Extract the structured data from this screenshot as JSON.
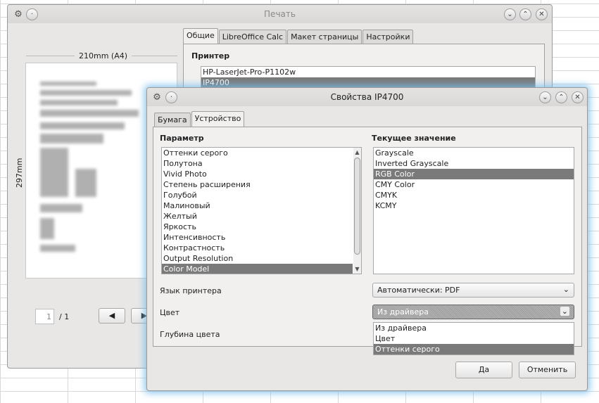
{
  "print_dialog": {
    "title": "Печать",
    "page_width_label": "210mm (A4)",
    "page_height_label": "297mm",
    "tabs": [
      "Общие",
      "LibreOffice Calc",
      "Макет страницы",
      "Настройки"
    ],
    "printer_section": "Принтер",
    "printers": [
      "HP-LaserJet-Pro-P1102w",
      "IP4700"
    ],
    "page_number": "1",
    "page_total": "/ 1"
  },
  "props_dialog": {
    "title": "Свойства IP4700",
    "tabs": [
      "Бумага",
      "Устройство"
    ],
    "param_header": "Параметр",
    "value_header": "Текущее значение",
    "params": [
      "Оттенки серого",
      "Полутона",
      "Vivid Photo",
      "Степень расширения",
      "Голубой",
      "Малиновый",
      "Желтый",
      "Яркость",
      "Интенсивность",
      "Контрастность",
      "Output Resolution",
      "Color Model"
    ],
    "selected_param_index": 11,
    "values": [
      "Grayscale",
      "Inverted Grayscale",
      "RGB Color",
      "CMY Color",
      "CMYK",
      "KCMY"
    ],
    "selected_value_index": 2,
    "printer_lang_label": "Язык принтера",
    "printer_lang_value": "Автоматически: PDF",
    "color_label": "Цвет",
    "color_value": "Из драйвера",
    "color_options": [
      "Из драйвера",
      "Цвет",
      "Оттенки серого"
    ],
    "selected_color_option_index": 2,
    "depth_label": "Глубина цвета",
    "ok_label": "Да",
    "cancel_label": "Отменить"
  }
}
